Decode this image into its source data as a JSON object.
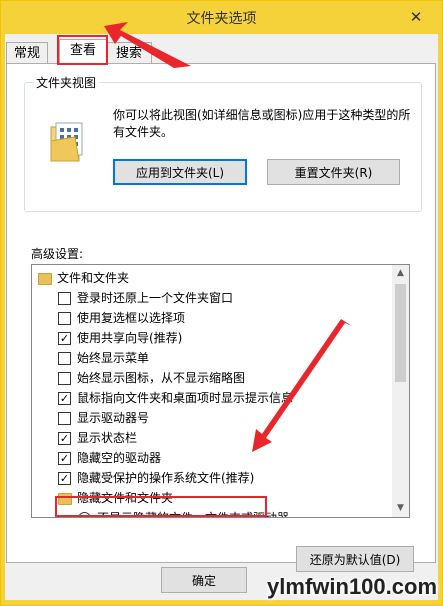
{
  "window": {
    "title": "文件夹选项"
  },
  "tabs": [
    {
      "label": "常规"
    },
    {
      "label": "查看"
    },
    {
      "label": "搜索"
    }
  ],
  "folder_views": {
    "legend": "文件夹视图",
    "description": "你可以将此视图(如详细信息或图标)应用于这种类型的所有文件夹。",
    "apply_button": "应用到文件夹(L)",
    "reset_button": "重置文件夹(R)"
  },
  "advanced": {
    "label": "高级设置:",
    "folder_root": "文件和文件夹",
    "items": [
      {
        "label": "登录时还原上一个文件夹窗口",
        "checked": false
      },
      {
        "label": "使用复选框以选择项",
        "checked": false
      },
      {
        "label": "使用共享向导(推荐)",
        "checked": true
      },
      {
        "label": "始终显示菜单",
        "checked": false
      },
      {
        "label": "始终显示图标，从不显示缩略图",
        "checked": false
      },
      {
        "label": "鼠标指向文件夹和桌面项时显示提示信息",
        "checked": true
      },
      {
        "label": "显示驱动器号",
        "checked": false
      },
      {
        "label": "显示状态栏",
        "checked": true
      },
      {
        "label": "隐藏空的驱动器",
        "checked": true
      },
      {
        "label": "隐藏受保护的操作系统文件(推荐)",
        "checked": true
      }
    ],
    "hidden_folder": "隐藏文件和文件夹",
    "hidden_option": "不显示隐藏的文件、文件夹或驱动器"
  },
  "restore_button": "还原为默认值(D)",
  "ok_button": "确定",
  "watermark": "ylmfwin100.com",
  "colors": {
    "titlebar": "#f6d23a",
    "highlight": "#e8262b"
  }
}
